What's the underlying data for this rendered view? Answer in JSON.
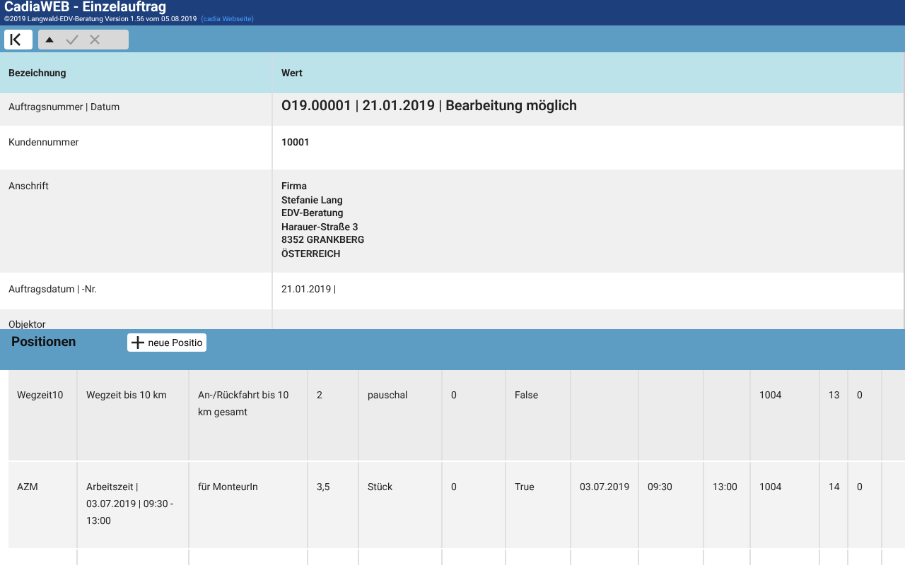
{
  "window": {
    "title": "CadiaWEB - Einzelauftrag",
    "subtitle": "©2019 Langwald-EDV-Beratung Version 1.56 vom 05.08.2019",
    "link": "(cadia Webseite)"
  },
  "toolbar": {
    "buttons": [
      {
        "kind": "first",
        "disabled": false
      },
      {
        "kind": "up",
        "disabled": false
      },
      {
        "kind": "confirm",
        "disabled": true
      },
      {
        "kind": "cancel",
        "disabled": true
      }
    ]
  },
  "details": {
    "columns": [
      "Bezeichnung",
      "Wert"
    ],
    "rows": [
      {
        "label": "Auftragsnummer | Datum",
        "value": [
          "O19.00001 | 21.01.2019 | Bearbeitung möglich"
        ],
        "kind": "headline"
      },
      {
        "label": "Kundennummer",
        "value": [
          "10001"
        ],
        "kind": "bold"
      },
      {
        "label": "Anschrift",
        "value": [
          "Firma",
          "Stefanie Lang",
          "EDV-Beratung",
          "Harauer-Straße 3",
          "8352 GRANKBERG",
          "ÖSTERREICH"
        ],
        "kind": "bold"
      },
      {
        "label": "Auftragsdatum | -Nr.",
        "value": [
          "21.01.2019 |"
        ],
        "kind": "plain"
      },
      {
        "label": "Objektor",
        "value": [],
        "kind": "plain"
      }
    ]
  },
  "positions": {
    "title": "Positionen",
    "add_button": "neue Positio",
    "rows": [
      [
        "Wegzeit10",
        "Wegzeit bis 10 km",
        "An-/Rückfahrt bis 10 km gesamt",
        "2",
        "pauschal",
        "0",
        "False",
        "",
        "",
        "",
        "1004",
        "13",
        "0"
      ],
      [
        "AZM",
        "Arbeitszeit | 03.07.2019 | 09:30 - 13:00",
        "für MonteurIn",
        "3,5",
        "Stück",
        "0",
        "True",
        "03.07.2019",
        "09:30",
        "13:00",
        "1004",
        "14",
        "0"
      ]
    ]
  }
}
